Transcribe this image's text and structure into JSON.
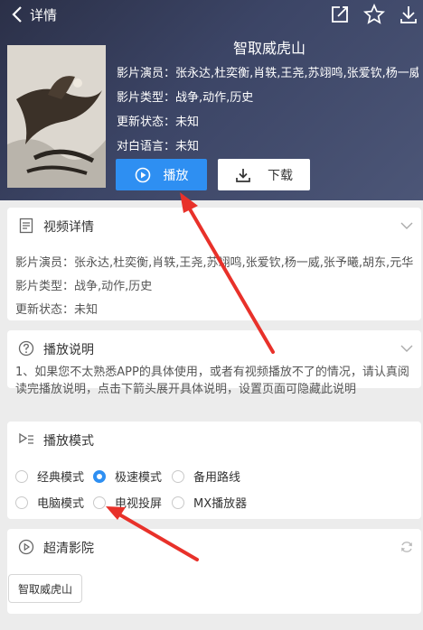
{
  "header": {
    "back_title": "详情",
    "movie_title": "智取威虎山",
    "actors_line": "影片演员：张永达,杜奕衡,肖轶,王尧,苏翊鸣,张爱钦,杨一威,张予曦,胡东,元华",
    "type_line": "影片类型：战争,动作,历史",
    "status_line": "更新状态：未知",
    "language_line": "对白语言：未知",
    "play_label": "播放",
    "download_label": "下载"
  },
  "video_detail": {
    "title": "视频详情",
    "actors": "影片演员：张永达,杜奕衡,肖轶,王尧,苏翊鸣,张爱钦,杨一威,张予曦,胡东,元华",
    "type": "影片类型：战争,动作,历史",
    "status": "更新状态：未知"
  },
  "play_info": {
    "title": "播放说明",
    "text": "1、如果您不太熟悉APP的具体使用，或者有视频播放不了的情况，请认真阅读完播放说明，点击下箭头展开具体说明，设置页面可隐藏此说明"
  },
  "play_mode": {
    "title": "播放模式",
    "options": [
      {
        "label": "经典模式",
        "checked": false
      },
      {
        "label": "极速模式",
        "checked": true
      },
      {
        "label": "备用路线",
        "checked": false
      },
      {
        "label": "电脑模式",
        "checked": false
      },
      {
        "label": "电视投屏",
        "checked": false
      },
      {
        "label": "MX播放器",
        "checked": false
      }
    ]
  },
  "hd_cinema": {
    "title": "超清影院",
    "chip": "智取威虎山"
  },
  "colors": {
    "accent": "#2e8ff2",
    "annotation_arrow": "#e8312a"
  }
}
